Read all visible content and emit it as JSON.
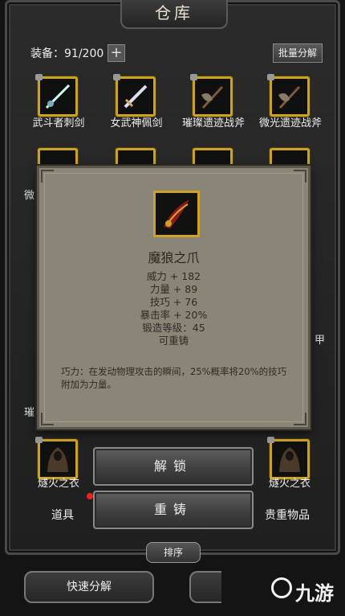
{
  "window": {
    "title": "仓库"
  },
  "header": {
    "equip_label": "装备：91/200",
    "plus_label": "+",
    "batch_button": "批量分解"
  },
  "items_row1": [
    {
      "label": "武斗者刺剑",
      "icon": "rapier-icon"
    },
    {
      "label": "女武神佩剑",
      "icon": "sword-icon"
    },
    {
      "label": "璀璨遗迹战斧",
      "icon": "battle-axe-icon"
    },
    {
      "label": "微光遗迹战斧",
      "icon": "battle-axe-icon"
    }
  ],
  "partial_labels": {
    "left_row2": "微",
    "right_row4": "甲",
    "left_row5": "璀"
  },
  "items_bottom": [
    {
      "label": "燧火之衣",
      "icon": "cloak-icon"
    },
    {
      "label": "燧火之衣",
      "icon": "cloak-icon"
    }
  ],
  "popup": {
    "icon": "claw-icon",
    "name": "魔狼之爪",
    "stats": [
      "威力 + 182",
      "力量 + 89",
      "技巧 + 76",
      "暴击率 + 20%",
      "锻造等级：45",
      "可重铸"
    ],
    "description": "巧力：在发动物理攻击的瞬间，25%概率将20%的技巧附加为力量。"
  },
  "actions": {
    "unlock": "解锁",
    "reforge": "重铸"
  },
  "tabs": {
    "left": "道具",
    "right": "贵重物品"
  },
  "footer": {
    "sort": "排序",
    "quick_decompose": "快速分解"
  },
  "watermark": {
    "text": "九游"
  },
  "colors": {
    "slot_border": "#c9a227",
    "popup_bg": "#8a8576",
    "badge": "#e22222"
  }
}
